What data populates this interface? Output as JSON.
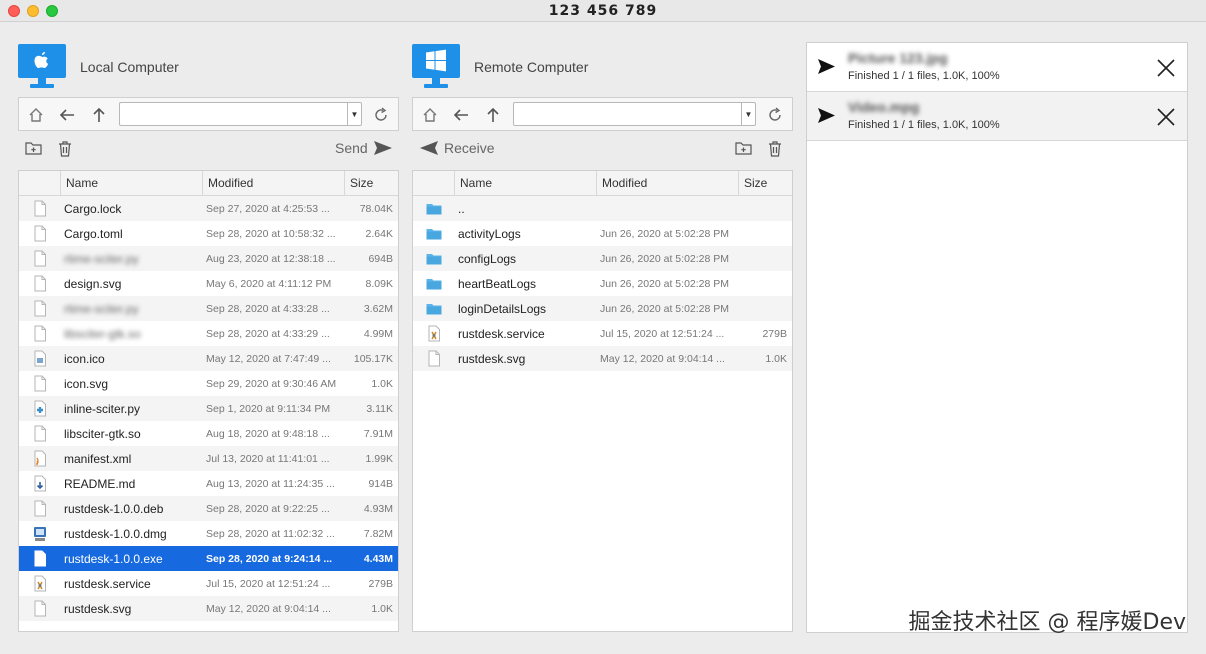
{
  "window": {
    "title": "123 456 789"
  },
  "local": {
    "title": "Local Computer",
    "path": "",
    "action_label": "Send",
    "columns": [
      "Name",
      "Modified",
      "Size"
    ],
    "rows": [
      {
        "name": "Cargo.lock",
        "modified": "Sep 27, 2020 at 4:25:53 ...",
        "size": "78.04K",
        "icon": "file-icon"
      },
      {
        "name": "Cargo.toml",
        "modified": "Sep 28, 2020 at 10:58:32 ...",
        "size": "2.64K",
        "icon": "file-icon"
      },
      {
        "name": "rtime-sciter.py",
        "modified": "Aug 23, 2020 at 12:38:18 ...",
        "size": "694B",
        "icon": "file-icon",
        "blurred": true
      },
      {
        "name": "design.svg",
        "modified": "May 6, 2020 at 4:11:12 PM",
        "size": "8.09K",
        "icon": "file-icon"
      },
      {
        "name": "rtime-sciter.py",
        "modified": "Sep 28, 2020 at 4:33:28 ...",
        "size": "3.62M",
        "icon": "file-icon",
        "blurred": true
      },
      {
        "name": "libsciter-gtk.so",
        "modified": "Sep 28, 2020 at 4:33:29 ...",
        "size": "4.99M",
        "icon": "file-icon",
        "blurred": true
      },
      {
        "name": "icon.ico",
        "modified": "May 12, 2020 at 7:47:49 ...",
        "size": "105.17K",
        "icon": "image-file-icon"
      },
      {
        "name": "icon.svg",
        "modified": "Sep 29, 2020 at 9:30:46 AM",
        "size": "1.0K",
        "icon": "file-icon"
      },
      {
        "name": "inline-sciter.py",
        "modified": "Sep 1, 2020 at 9:11:34 PM",
        "size": "3.11K",
        "icon": "python-file-icon"
      },
      {
        "name": "libsciter-gtk.so",
        "modified": "Aug 18, 2020 at 9:48:18 ...",
        "size": "7.91M",
        "icon": "file-icon"
      },
      {
        "name": "manifest.xml",
        "modified": "Jul 13, 2020 at 11:41:01 ...",
        "size": "1.99K",
        "icon": "xml-file-icon"
      },
      {
        "name": "README.md",
        "modified": "Aug 13, 2020 at 11:24:35 ...",
        "size": "914B",
        "icon": "markdown-file-icon"
      },
      {
        "name": "rustdesk-1.0.0.deb",
        "modified": "Sep 28, 2020 at 9:22:25 ...",
        "size": "4.93M",
        "icon": "file-icon"
      },
      {
        "name": "rustdesk-1.0.0.dmg",
        "modified": "Sep 28, 2020 at 11:02:32 ...",
        "size": "7.82M",
        "icon": "disk-image-icon"
      },
      {
        "name": "rustdesk-1.0.0.exe",
        "modified": "Sep 28, 2020 at 9:24:14 ...",
        "size": "4.43M",
        "icon": "file-icon",
        "selected": true
      },
      {
        "name": "rustdesk.service",
        "modified": "Jul 15, 2020 at 12:51:24 ...",
        "size": "279B",
        "icon": "service-file-icon"
      },
      {
        "name": "rustdesk.svg",
        "modified": "May 12, 2020 at 9:04:14 ...",
        "size": "1.0K",
        "icon": "file-icon"
      }
    ]
  },
  "remote": {
    "title": "Remote Computer",
    "path": "",
    "action_label": "Receive",
    "columns": [
      "Name",
      "Modified",
      "Size"
    ],
    "rows": [
      {
        "name": "..",
        "modified": "",
        "size": "",
        "icon": "folder-icon"
      },
      {
        "name": "activityLogs",
        "modified": "Jun 26, 2020 at 5:02:28 PM",
        "size": "",
        "icon": "folder-icon"
      },
      {
        "name": "configLogs",
        "modified": "Jun 26, 2020 at 5:02:28 PM",
        "size": "",
        "icon": "folder-icon"
      },
      {
        "name": "heartBeatLogs",
        "modified": "Jun 26, 2020 at 5:02:28 PM",
        "size": "",
        "icon": "folder-icon"
      },
      {
        "name": "loginDetailsLogs",
        "modified": "Jun 26, 2020 at 5:02:28 PM",
        "size": "",
        "icon": "folder-icon"
      },
      {
        "name": "rustdesk.service",
        "modified": "Jul 15, 2020 at 12:51:24 ...",
        "size": "279B",
        "icon": "service-file-icon"
      },
      {
        "name": "rustdesk.svg",
        "modified": "May 12, 2020 at 9:04:14 ...",
        "size": "1.0K",
        "icon": "file-icon"
      }
    ]
  },
  "transfers": [
    {
      "name": "Picture 123.jpg",
      "status": "Finished 1 / 1 files, 1.0K, 100%"
    },
    {
      "name": "Video.mpg",
      "status": "Finished 1 / 1 files, 1.0K, 100%"
    }
  ],
  "watermark": "掘金技术社区 @ 程序媛Dev"
}
